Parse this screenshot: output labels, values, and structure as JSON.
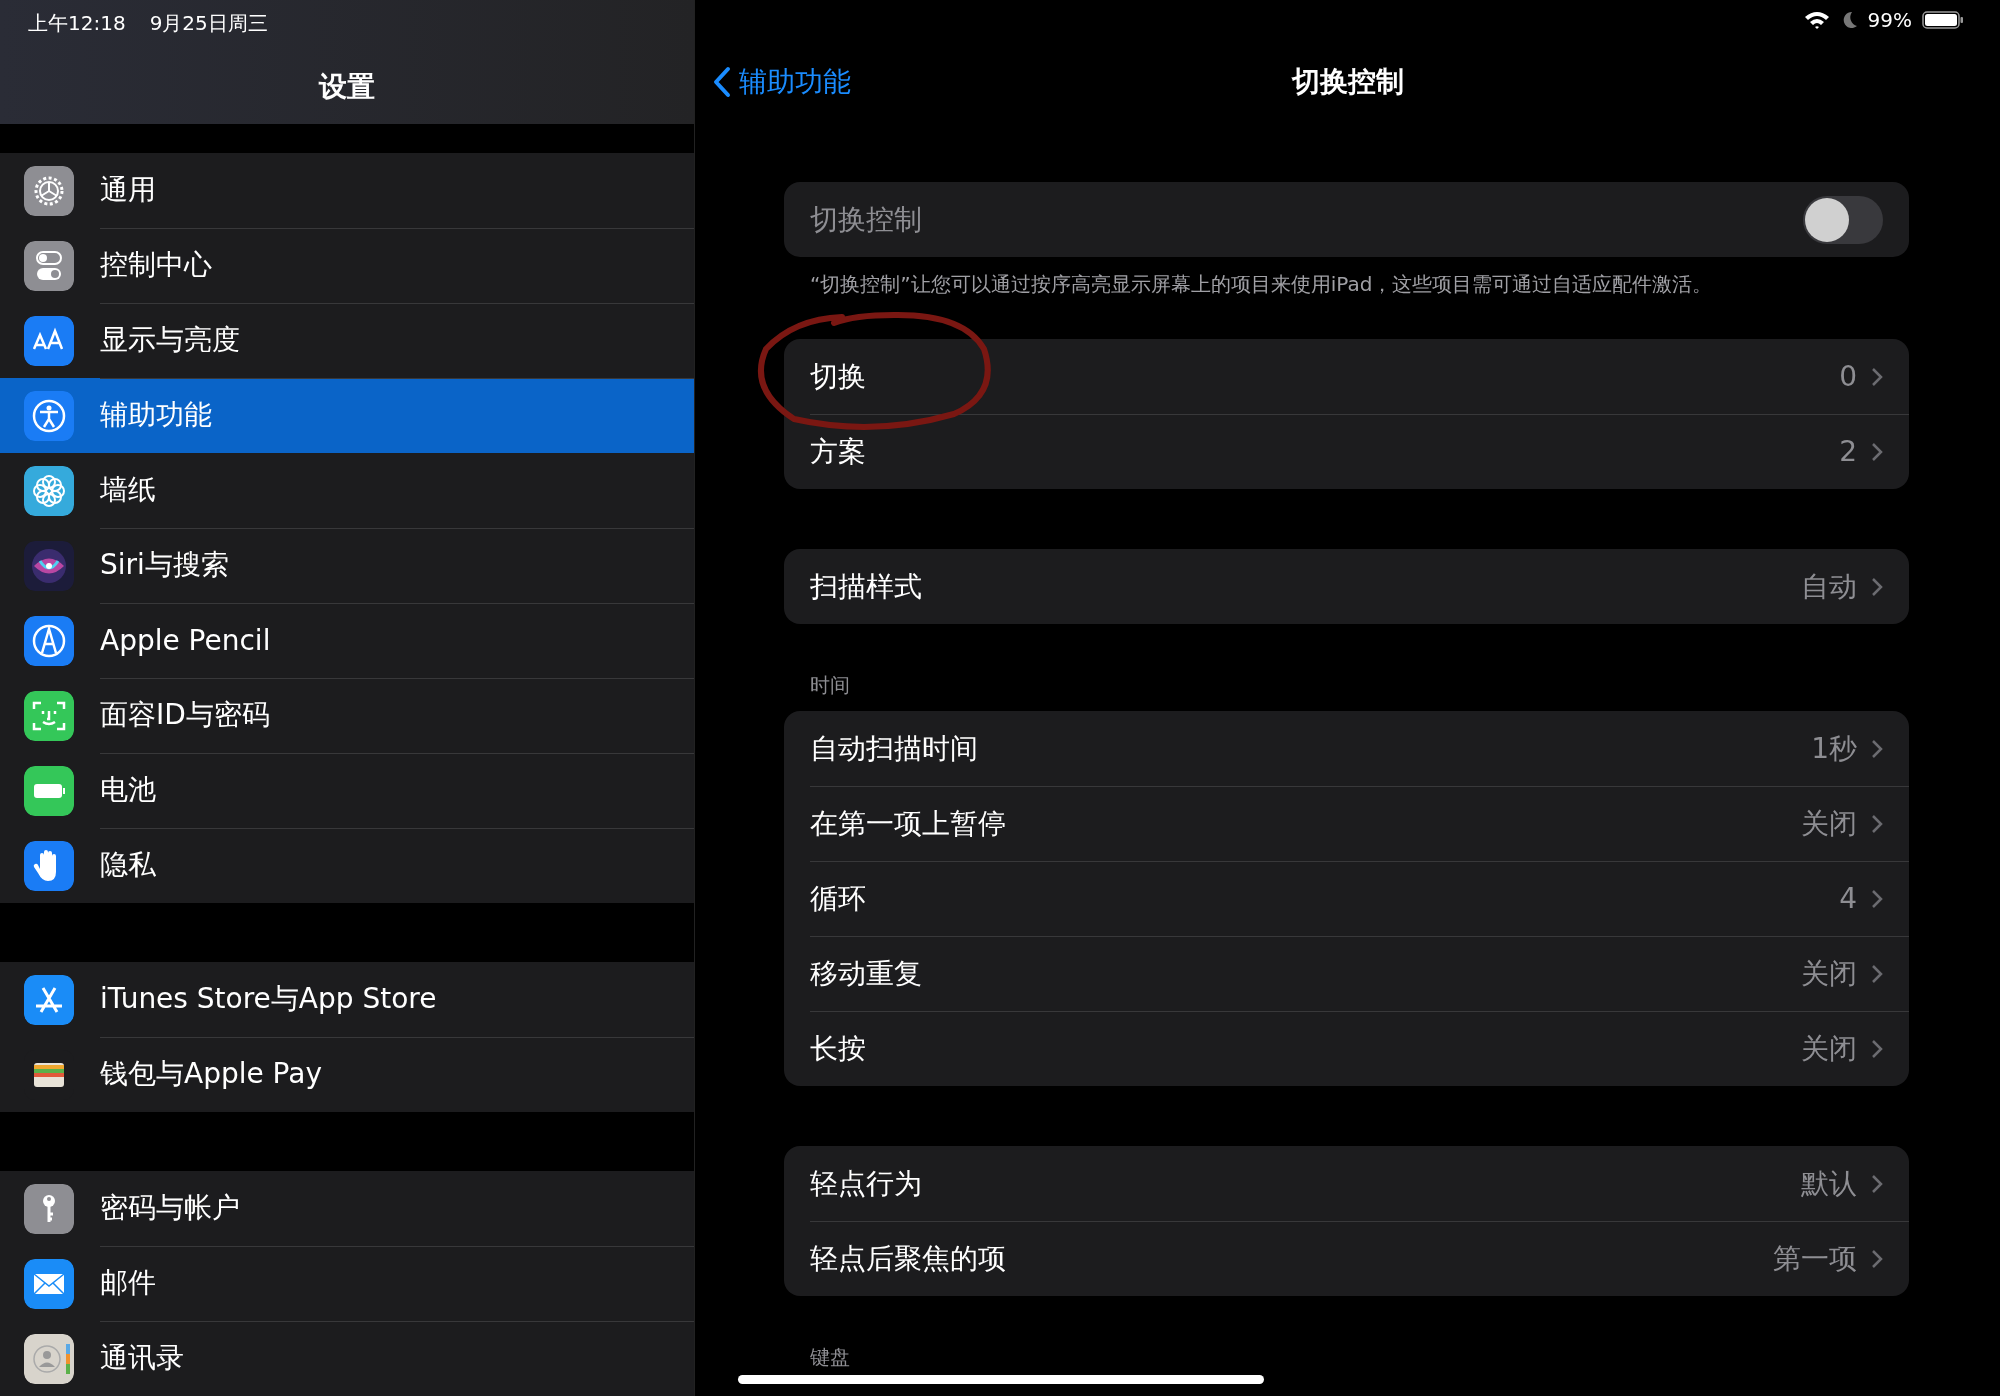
{
  "status_bar": {
    "time": "上午12:18",
    "date": "9月25日周三",
    "battery": "99%"
  },
  "sidebar": {
    "title": "设置",
    "groups": [
      [
        {
          "label": "通用",
          "selected": false
        },
        {
          "label": "控制中心",
          "selected": false
        },
        {
          "label": "显示与亮度",
          "selected": false
        },
        {
          "label": "辅助功能",
          "selected": true
        },
        {
          "label": "墙纸",
          "selected": false
        },
        {
          "label": "Siri与搜索",
          "selected": false
        },
        {
          "label": "Apple Pencil",
          "selected": false
        },
        {
          "label": "面容ID与密码",
          "selected": false
        },
        {
          "label": "电池",
          "selected": false
        },
        {
          "label": "隐私",
          "selected": false
        }
      ],
      [
        {
          "label": "iTunes Store与App Store",
          "selected": false
        },
        {
          "label": "钱包与Apple Pay",
          "selected": false
        }
      ],
      [
        {
          "label": "密码与帐户",
          "selected": false
        },
        {
          "label": "邮件",
          "selected": false
        },
        {
          "label": "通讯录",
          "selected": false
        }
      ]
    ]
  },
  "detail": {
    "back": "辅助功能",
    "title": "切换控制",
    "toggle": {
      "label": "切换控制",
      "on": false
    },
    "description": "“切换控制”让您可以通过按序高亮显示屏幕上的项目来使用iPad，这些项目需可通过自适应配件激活。",
    "sections": [
      {
        "rows": [
          {
            "label": "切换",
            "value": "0",
            "circled": true
          },
          {
            "label": "方案",
            "value": "2",
            "circled": false
          }
        ]
      },
      {
        "rows": [
          {
            "label": "扫描样式",
            "value": "自动",
            "circled": false
          }
        ]
      },
      {
        "header": "时间",
        "rows": [
          {
            "label": "自动扫描时间",
            "value": "1秒",
            "circled": false
          },
          {
            "label": "在第一项上暂停",
            "value": "关闭",
            "circled": false
          },
          {
            "label": "循环",
            "value": "4",
            "circled": false
          },
          {
            "label": "移动重复",
            "value": "关闭",
            "circled": false
          },
          {
            "label": "长按",
            "value": "关闭",
            "circled": false
          }
        ]
      },
      {
        "rows": [
          {
            "label": "轻点行为",
            "value": "默认",
            "circled": false
          },
          {
            "label": "轻点后聚焦的项",
            "value": "第一项",
            "circled": false
          }
        ]
      },
      {
        "header": "键盘"
      }
    ]
  }
}
